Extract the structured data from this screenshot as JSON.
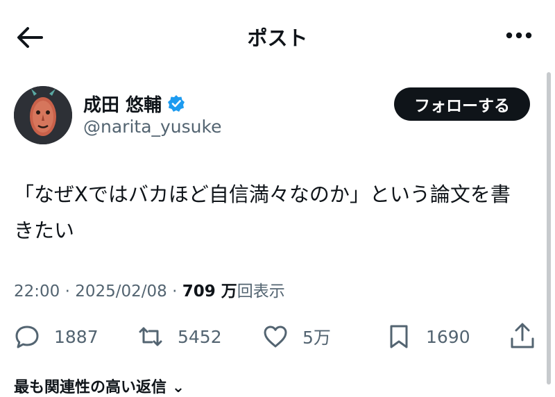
{
  "header": {
    "title": "ポスト",
    "back_icon": "back-arrow-icon",
    "more_icon": "more-dots-icon"
  },
  "author": {
    "name": "成田 悠輔",
    "handle": "@narita_yusuke",
    "verified_color": "#1d9bf0",
    "follow_label": "フォローする"
  },
  "post": {
    "text_line1": "「なぜXではバカほど自信満々なのか」という論文を書",
    "text_line2": "きたい",
    "time": "22:00",
    "date": "2025/02/08",
    "views_number": "709",
    "views_unit": "万",
    "views_suffix": "回表示"
  },
  "actions": {
    "replies": "1887",
    "reposts": "5452",
    "likes": "5万",
    "bookmarks": "1690"
  },
  "replies_sort_label": "最も関連性の高い返信"
}
